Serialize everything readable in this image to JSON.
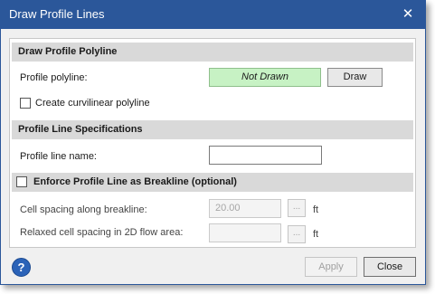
{
  "window": {
    "title": "Draw Profile Lines",
    "close_glyph": "✕"
  },
  "draw_section": {
    "header": "Draw Profile Polyline",
    "polyline_label": "Profile polyline:",
    "polyline_status": "Not Drawn",
    "draw_button": "Draw",
    "curvilinear_label": "Create curvilinear polyline",
    "curvilinear_checked": false
  },
  "spec_section": {
    "header": "Profile Line Specifications",
    "name_label": "Profile line name:",
    "name_value": ""
  },
  "breakline_section": {
    "header": "Enforce Profile Line as Breakline (optional)",
    "enforce_checked": false,
    "spacing_label": "Cell spacing along breakline:",
    "spacing_value": "20.00",
    "spacing_unit": "ft",
    "relaxed_label": "Relaxed cell spacing in 2D flow area:",
    "relaxed_value": "",
    "relaxed_unit": "ft",
    "ellipsis": "..."
  },
  "footer": {
    "help_glyph": "?",
    "help_icon": "help-icon",
    "apply_button": "Apply",
    "close_button": "Close"
  },
  "colors": {
    "titlebar": "#2b579a",
    "status_fill": "#c7f2c4",
    "section_header": "#d9d9d9"
  }
}
